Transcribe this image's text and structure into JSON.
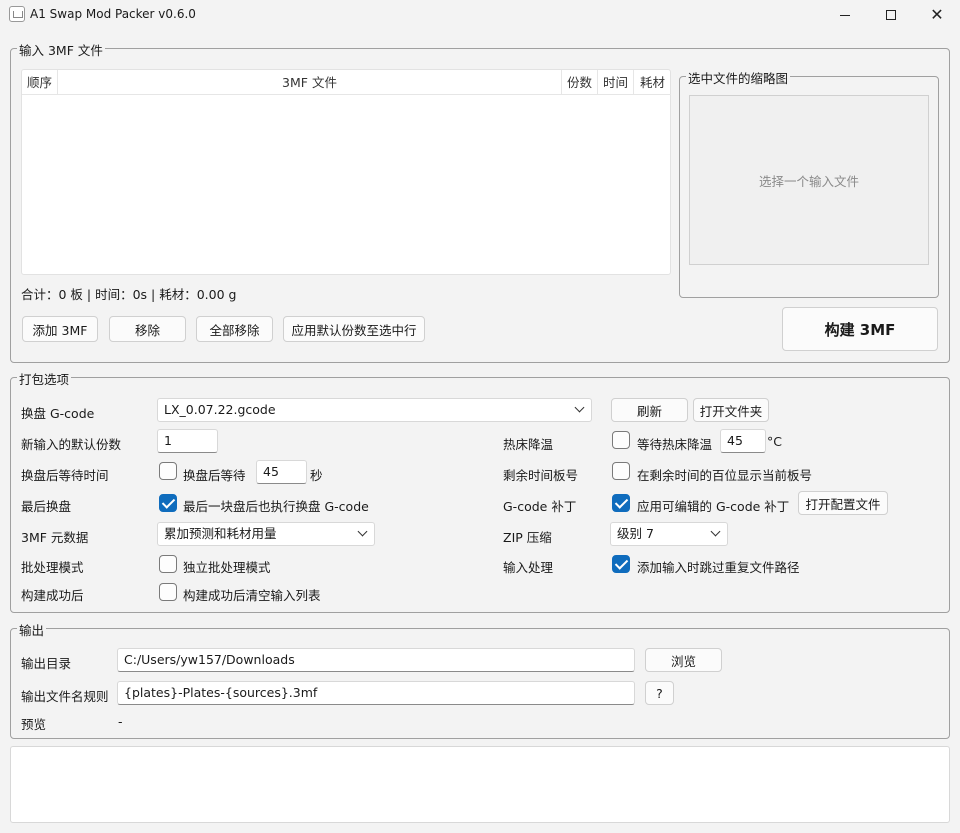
{
  "window": {
    "title": "A1 Swap Mod Packer v0.6.0"
  },
  "input_group": {
    "legend": "输入 3MF 文件",
    "columns": [
      "顺序",
      "3MF 文件",
      "份数",
      "时间",
      "耗材"
    ],
    "summary": "合计：0 板 | 时间：0s | 耗材：0.00 g",
    "buttons": {
      "add": "添加 3MF",
      "remove": "移除",
      "remove_all": "全部移除",
      "apply_default": "应用默认份数至选中行"
    }
  },
  "thumbnail": {
    "legend": "选中文件的缩略图",
    "placeholder": "选择一个输入文件"
  },
  "build_button": "构建 3MF",
  "pack_options": {
    "legend": "打包选项",
    "swap_gcode": {
      "label": "换盘 G-code",
      "value": "LX_0.07.22.gcode",
      "refresh": "刷新",
      "open_folder": "打开文件夹"
    },
    "default_copies": {
      "label": "新输入的默认份数",
      "value": "1"
    },
    "bed_cooling": {
      "label": "热床降温",
      "checkbox": "等待热床降温",
      "checked": false,
      "value": "45",
      "unit": "°C"
    },
    "wait_after_swap": {
      "label": "换盘后等待时间",
      "checkbox": "换盘后等待",
      "checked": false,
      "value": "45",
      "unit": "秒"
    },
    "remaining_time": {
      "label": "剩余时间板号",
      "checkbox": "在剩余时间的百位显示当前板号",
      "checked": false
    },
    "last_swap": {
      "label": "最后换盘",
      "checkbox": "最后一块盘后也执行换盘 G-code",
      "checked": true
    },
    "gcode_patch": {
      "label": "G-code 补丁",
      "checkbox": "应用可编辑的 G-code 补丁",
      "checked": true,
      "button": "打开配置文件"
    },
    "metadata": {
      "label": "3MF 元数据",
      "value": "累加预测和耗材用量"
    },
    "zip": {
      "label": "ZIP 压缩",
      "value": "级别 7"
    },
    "batch": {
      "label": "批处理模式",
      "checkbox": "独立批处理模式",
      "checked": false
    },
    "input_processing": {
      "label": "输入处理",
      "checkbox": "添加输入时跳过重复文件路径",
      "checked": true
    },
    "after_build": {
      "label": "构建成功后",
      "checkbox": "构建成功后清空输入列表",
      "checked": false
    }
  },
  "output": {
    "legend": "输出",
    "dir": {
      "label": "输出目录",
      "value": "C:/Users/yw157/Downloads",
      "button": "浏览"
    },
    "filename": {
      "label": "输出文件名规则",
      "value": "{plates}-Plates-{sources}.3mf",
      "button": "?"
    },
    "preview": {
      "label": "预览",
      "value": "-"
    }
  },
  "colors": {
    "accent": "#0f6cbd",
    "background": "#f3f3f3"
  }
}
